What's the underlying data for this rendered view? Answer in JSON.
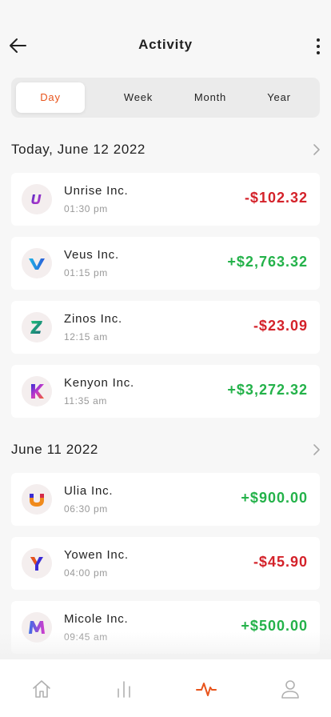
{
  "header": {
    "title": "Activity"
  },
  "tabs": [
    {
      "label": "Day",
      "active": true
    },
    {
      "label": "Week",
      "active": false
    },
    {
      "label": "Month",
      "active": false
    },
    {
      "label": "Year",
      "active": false
    }
  ],
  "groups": [
    {
      "title": "Today, June 12 2022",
      "items": [
        {
          "name": "Unrise Inc.",
          "time": "01:30 pm",
          "amount": "-$102.32",
          "type": "neg",
          "logo": "U"
        },
        {
          "name": "Veus Inc.",
          "time": "01:15 pm",
          "amount": "+$2,763.32",
          "type": "pos",
          "logo": "V"
        },
        {
          "name": "Zinos Inc.",
          "time": "12:15 am",
          "amount": "-$23.09",
          "type": "neg",
          "logo": "Z"
        },
        {
          "name": "Kenyon Inc.",
          "time": "11:35 am",
          "amount": "+$3,272.32",
          "type": "pos",
          "logo": "K"
        }
      ]
    },
    {
      "title": "June 11 2022",
      "items": [
        {
          "name": "Ulia Inc.",
          "time": "06:30 pm",
          "amount": "+$900.00",
          "type": "pos",
          "logo": "U"
        },
        {
          "name": "Yowen Inc.",
          "time": "04:00 pm",
          "amount": "-$45.90",
          "type": "neg",
          "logo": "Y"
        },
        {
          "name": "Micole Inc.",
          "time": "09:45 am",
          "amount": "+$500.00",
          "type": "pos",
          "logo": "M"
        }
      ]
    }
  ],
  "colors": {
    "accent": "#e8541c",
    "positive": "#24b24a",
    "negative": "#d4222a"
  },
  "bottom_nav": [
    {
      "icon": "home-icon",
      "active": false
    },
    {
      "icon": "bar-chart-icon",
      "active": false
    },
    {
      "icon": "activity-icon",
      "active": true
    },
    {
      "icon": "profile-icon",
      "active": false
    }
  ]
}
